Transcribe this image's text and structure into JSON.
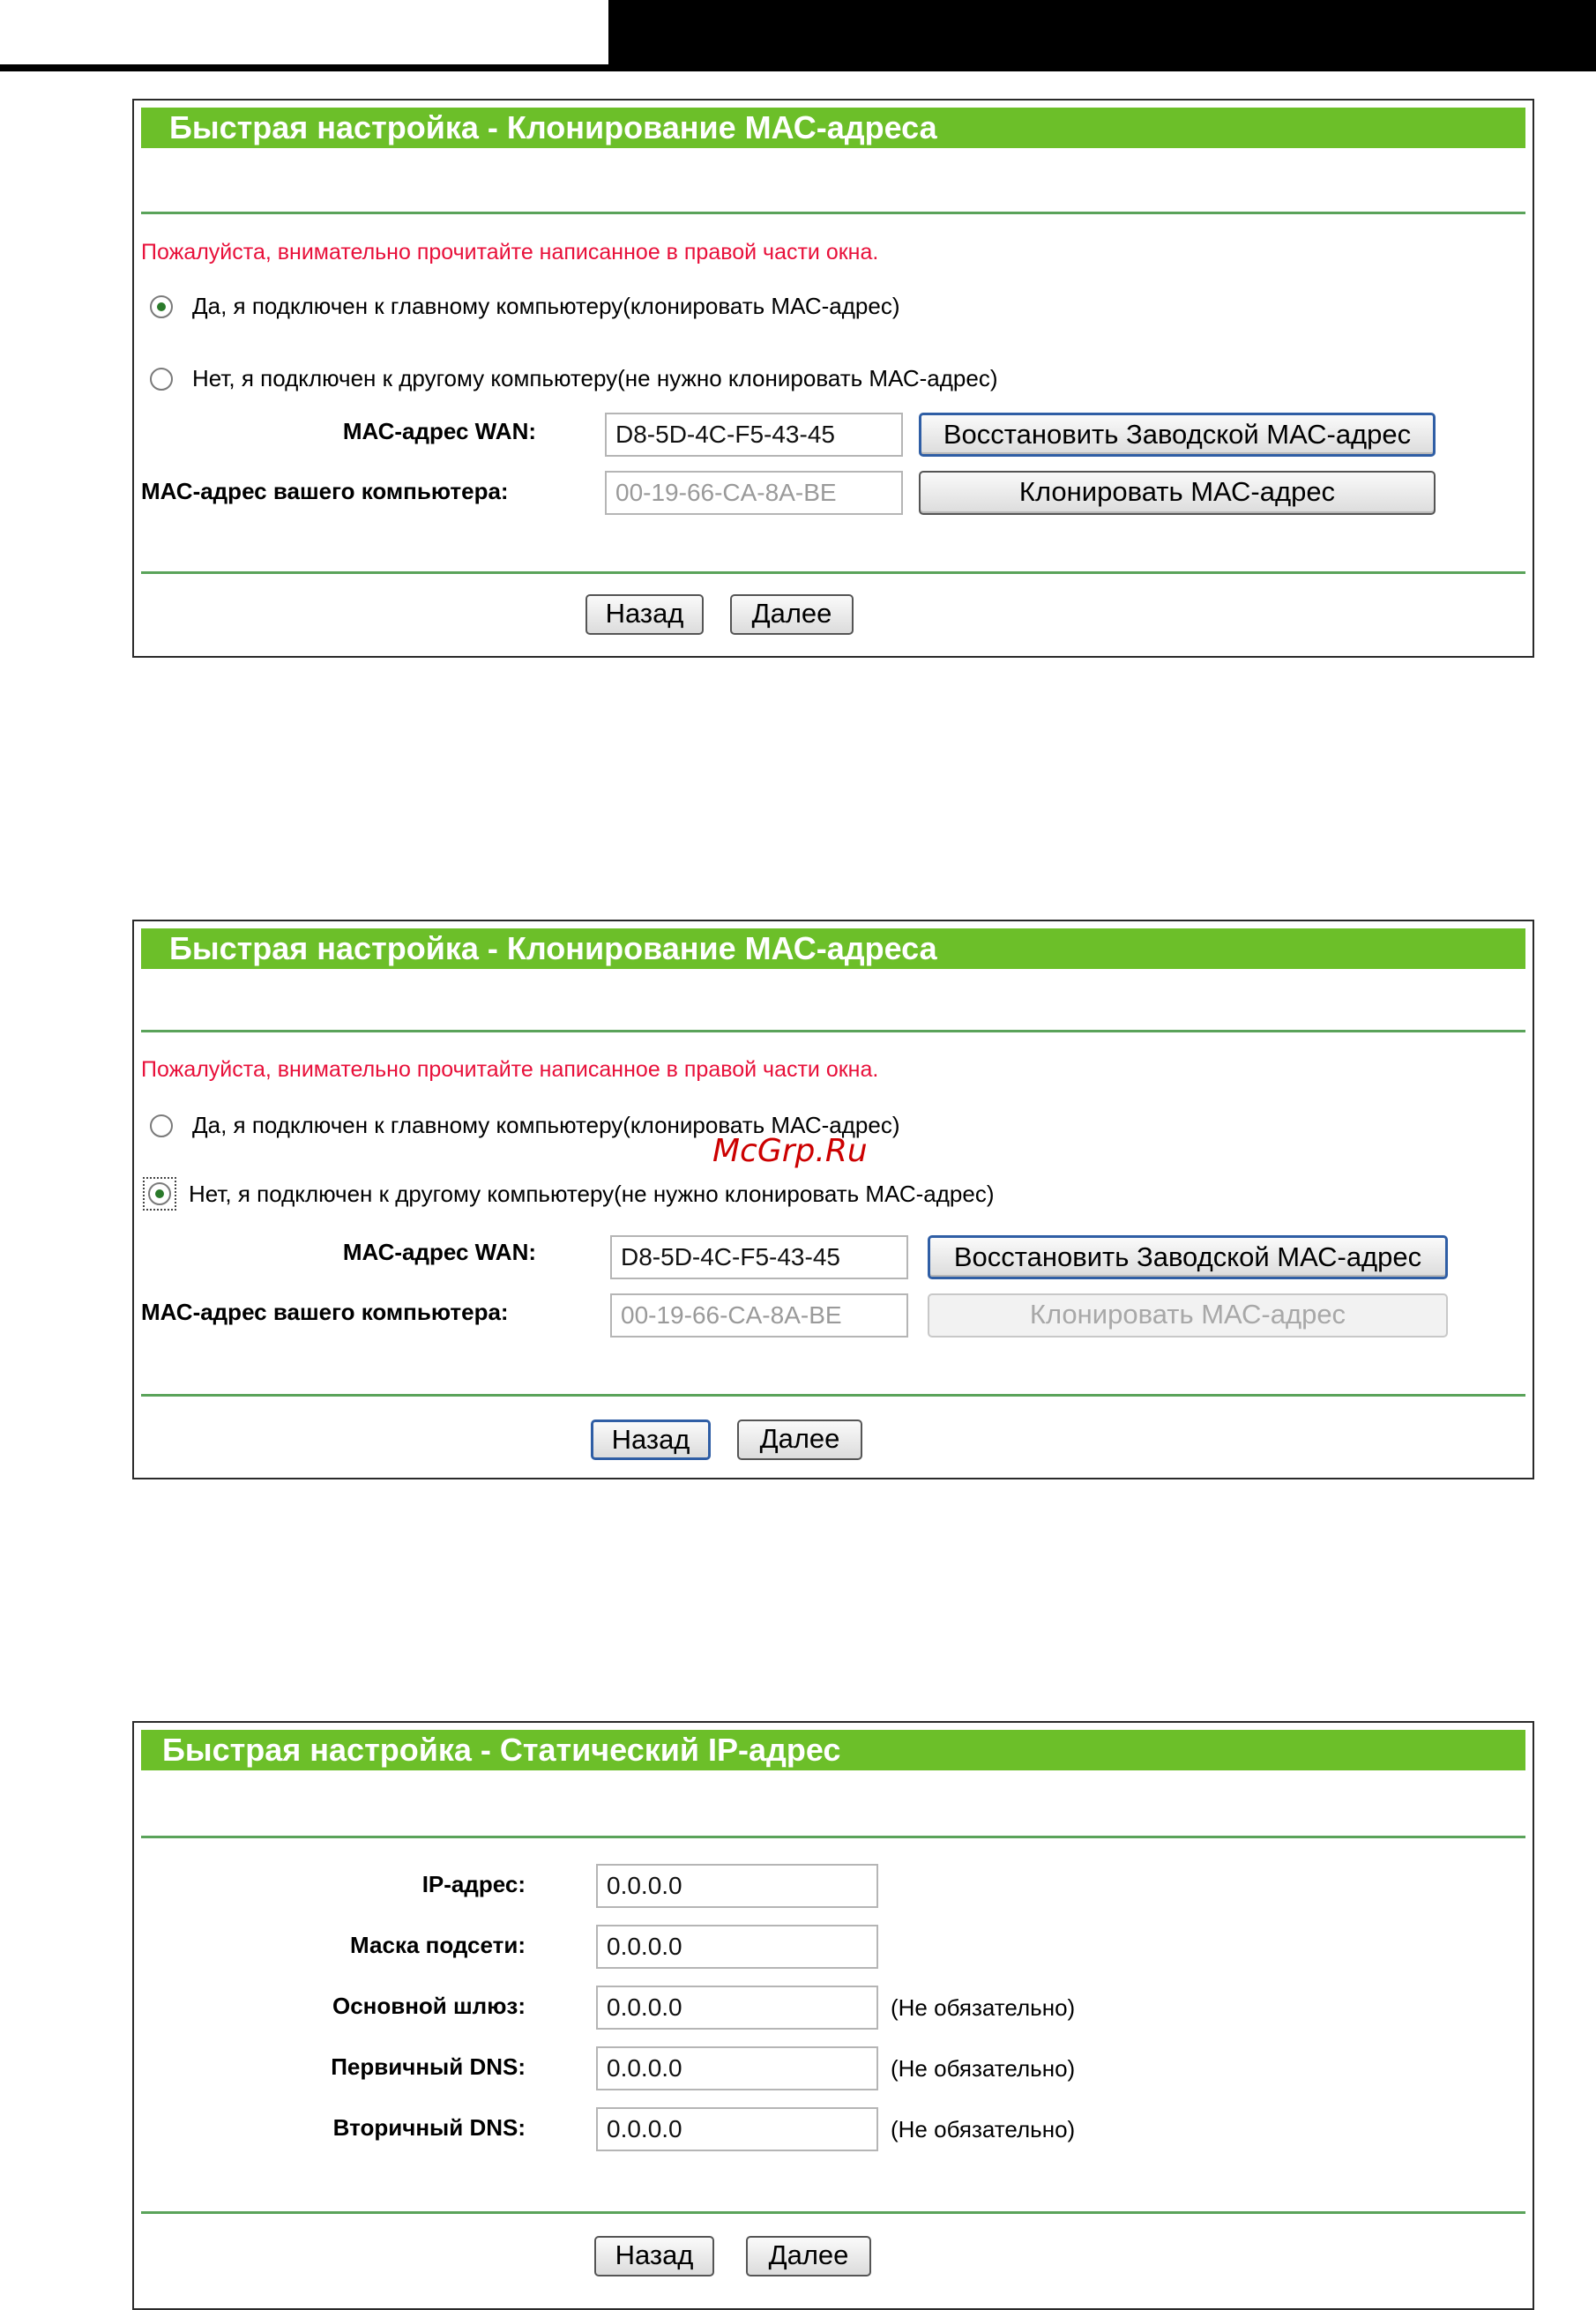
{
  "panel1": {
    "title": "Быстрая настройка - Клонирование МАС-адреса",
    "warning": "Пожалуйста, внимательно прочитайте написанное в правой части окна.",
    "option_yes": "Да, я подключен к главному компьютеру(клонировать МАС-адрес)",
    "option_no": "Нет, я подключен к другому компьютеру(не нужно клонировать МАС-адрес)",
    "selected": "yes",
    "wan_label": "МАС-адрес WAN:",
    "wan_value": "D8-5D-4C-F5-43-45",
    "pc_label": "МАС-адрес вашего компьютера:",
    "pc_value": "00-19-66-CA-8A-BE",
    "restore_btn": "Восстановить Заводской МАС-адрес",
    "clone_btn": "Клонировать МАС-адрес",
    "back_btn": "Назад",
    "next_btn": "Далее"
  },
  "panel2": {
    "title": "Быстрая настройка - Клонирование МАС-адреса",
    "warning": "Пожалуйста, внимательно прочитайте написанное в правой части окна.",
    "option_yes": "Да, я подключен к главному компьютеру(клонировать МАС-адрес)",
    "option_no": "Нет, я подключен к другому компьютеру(не нужно клонировать МАС-адрес)",
    "selected": "no",
    "wan_label": "МАС-адрес WAN:",
    "wan_value": "D8-5D-4C-F5-43-45",
    "pc_label": "МАС-адрес вашего компьютера:",
    "pc_value": "00-19-66-CA-8A-BE",
    "restore_btn": "Восстановить Заводской МАС-адрес",
    "clone_btn": "Клонировать МАС-адрес",
    "back_btn": "Назад",
    "next_btn": "Далее"
  },
  "panel3": {
    "title": "Быстрая настройка - Статический IP-адрес",
    "rows": [
      {
        "label": "IP-адрес:",
        "value": "0.0.0.0",
        "note": ""
      },
      {
        "label": "Маска подсети:",
        "value": "0.0.0.0",
        "note": ""
      },
      {
        "label": "Основной шлюз:",
        "value": "0.0.0.0",
        "note": "(Не обязательно)"
      },
      {
        "label": "Первичный DNS:",
        "value": "0.0.0.0",
        "note": "(Не обязательно)"
      },
      {
        "label": "Вторичный DNS:",
        "value": "0.0.0.0",
        "note": "(Не обязательно)"
      }
    ],
    "back_btn": "Назад",
    "next_btn": "Далее"
  },
  "watermark": "McGrp.Ru",
  "colors": {
    "title_bar": "#6cbf29",
    "warning": "#e8103a",
    "divider": "#5aa35a"
  }
}
